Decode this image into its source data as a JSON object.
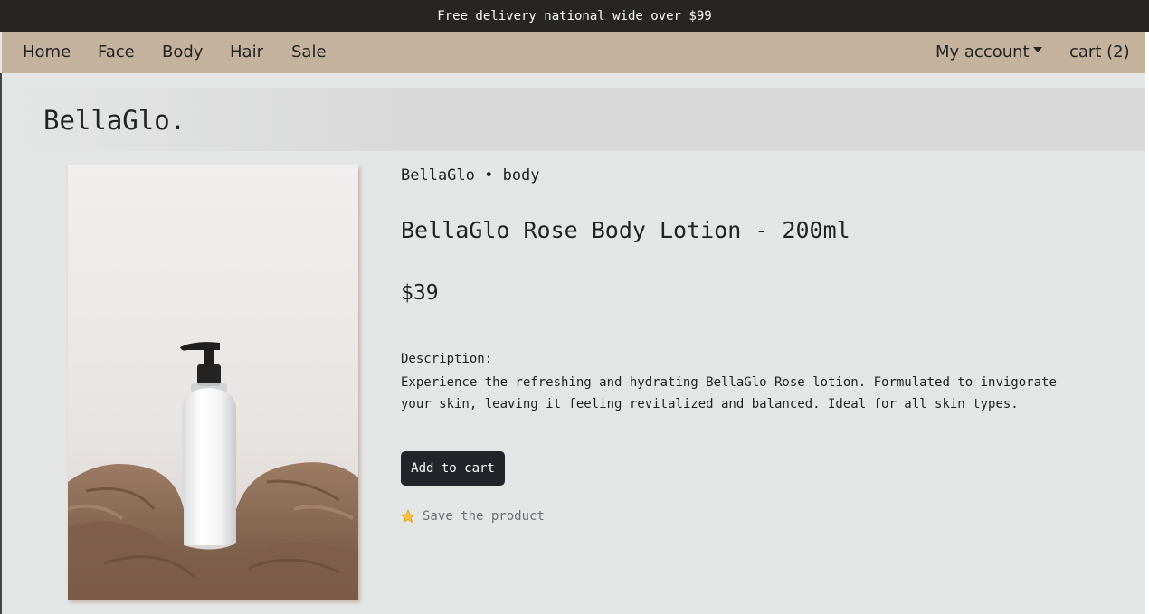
{
  "promo": {
    "text": "Free delivery national wide over $99"
  },
  "nav": {
    "items": [
      {
        "label": "Home"
      },
      {
        "label": "Face"
      },
      {
        "label": "Body"
      },
      {
        "label": "Hair"
      },
      {
        "label": "Sale"
      }
    ],
    "account_label": "My account",
    "cart_label": "cart (2)"
  },
  "brand": {
    "name": "BellaGlo."
  },
  "product": {
    "breadcrumb": "BellaGlo • body",
    "title": "BellaGlo Rose Body Lotion - 200ml",
    "price": "$39",
    "description_label": "Description:",
    "description": "Experience the refreshing and hydrating BellaGlo Rose lotion. Formulated to invigorate your skin, leaving it feeling revitalized and balanced. Ideal for all skin types.",
    "add_to_cart_label": "Add to cart",
    "save_label": "Save the product"
  },
  "colors": {
    "promo_bg": "#272424",
    "nav_bg": "#c4b29c",
    "page_bg": "#e4e6e5",
    "button_bg": "#212529",
    "muted_text": "#6b6f72"
  },
  "icons": {
    "save": "star-icon",
    "account_dropdown": "caret-down-icon"
  }
}
